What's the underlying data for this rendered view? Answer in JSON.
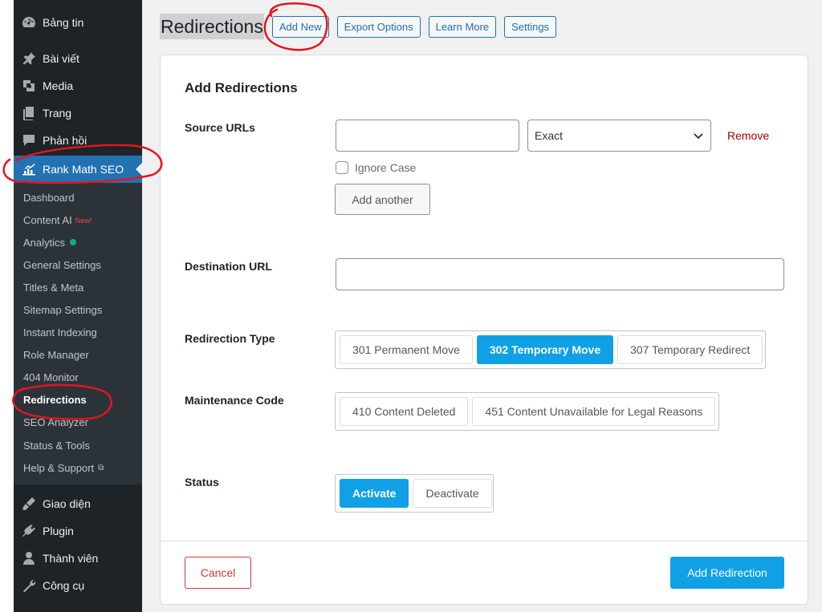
{
  "sidebar": {
    "top_items": [
      {
        "label": "Bảng tin",
        "icon": "dashboard-icon"
      },
      {
        "label": "Bài viết",
        "icon": "pin-icon"
      },
      {
        "label": "Media",
        "icon": "media-icon"
      },
      {
        "label": "Trang",
        "icon": "pages-icon"
      },
      {
        "label": "Phản hồi",
        "icon": "comments-icon"
      }
    ],
    "active_item": {
      "label": "Rank Math SEO",
      "icon": "rank-math-icon"
    },
    "submenu": [
      {
        "label": "Dashboard"
      },
      {
        "label": "Content AI",
        "badge": "New!"
      },
      {
        "label": "Analytics"
      },
      {
        "label": "General Settings"
      },
      {
        "label": "Titles & Meta"
      },
      {
        "label": "Sitemap Settings"
      },
      {
        "label": "Instant Indexing"
      },
      {
        "label": "Role Manager"
      },
      {
        "label": "404 Monitor"
      },
      {
        "label": "Redirections"
      },
      {
        "label": "SEO Analyzer"
      },
      {
        "label": "Status & Tools"
      },
      {
        "label": "Help & Support"
      }
    ],
    "bottom_items": [
      {
        "label": "Giao diện",
        "icon": "appearance-icon"
      },
      {
        "label": "Plugin",
        "icon": "plugin-icon"
      },
      {
        "label": "Thành viên",
        "icon": "users-icon"
      },
      {
        "label": "Công cụ",
        "icon": "tools-icon"
      }
    ]
  },
  "header": {
    "title": "Redirections",
    "buttons": [
      "Add New",
      "Export Options",
      "Learn More",
      "Settings"
    ]
  },
  "form": {
    "heading": "Add Redirections",
    "source_label": "Source URLs",
    "source_value": "",
    "match_type": "Exact",
    "remove_label": "Remove",
    "ignore_case_label": "Ignore Case",
    "add_another_label": "Add another",
    "destination_label": "Destination URL",
    "destination_value": "",
    "redirection_type_label": "Redirection Type",
    "redirection_types": [
      "301 Permanent Move",
      "302 Temporary Move",
      "307 Temporary Redirect"
    ],
    "redirection_type_selected": "302 Temporary Move",
    "maintenance_label": "Maintenance Code",
    "maintenance_codes": [
      "410 Content Deleted",
      "451 Content Unavailable for Legal Reasons"
    ],
    "status_label": "Status",
    "status_options": [
      "Activate",
      "Deactivate"
    ],
    "status_selected": "Activate",
    "cancel_label": "Cancel",
    "submit_label": "Add Redirection"
  },
  "colors": {
    "sidebar_bg": "#1d2327",
    "active_menu": "#2271b1",
    "accent_button": "#10a0e6",
    "cancel_red": "#d63638",
    "annotation_red": "#e0161d"
  }
}
